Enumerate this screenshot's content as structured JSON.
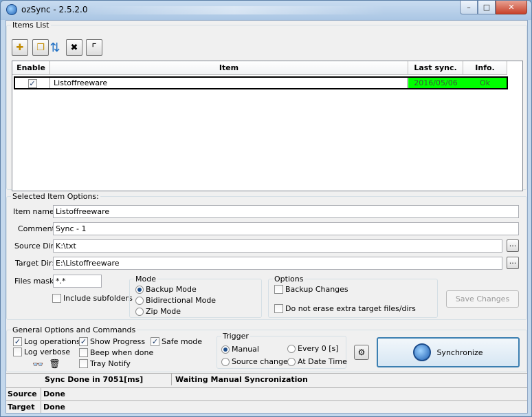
{
  "window": {
    "title": "ozSync - 2.5.2.0",
    "min": "–",
    "max": "□",
    "close": "✕"
  },
  "items_list": {
    "legend": "Items List",
    "toolbar": [
      {
        "name": "new-item-button",
        "glyph": "✚"
      },
      {
        "name": "copy-item-button",
        "glyph": "❐"
      },
      {
        "name": "move-item-button",
        "glyph": "⇅"
      },
      {
        "name": "delete-item-button",
        "glyph": "✖"
      },
      {
        "name": "properties-button",
        "glyph": "⌜"
      }
    ],
    "columns": {
      "enable": "Enable",
      "item": "Item",
      "last_sync": "Last sync.",
      "info": "Info."
    },
    "rows": [
      {
        "enabled": true,
        "item": "Listoffreeware",
        "last_sync": "2016/05/06",
        "info": "Ok"
      }
    ],
    "status_color": "#00ff00"
  },
  "options": {
    "legend": "Selected Item Options:",
    "item_name_label": "Item name:",
    "item_name": "Listoffreeware",
    "comment_label": "Comment:",
    "comment": "Sync - 1",
    "source_label": "Source Dir:",
    "source": "K:\\txt",
    "target_label": "Target Dir:",
    "target": "E:\\Listoffreeware",
    "browse": "...",
    "mask_label": "Files mask:",
    "mask": "*.*",
    "include_subfolders": "Include subfolders",
    "mode_legend": "Mode",
    "modes": [
      "Backup Mode",
      "Bidirectional Mode",
      "Zip Mode"
    ],
    "options_legend": "Options",
    "backup_changes": "Backup Changes",
    "no_erase": "Do not erase extra target files/dirs",
    "save_changes": "Save Changes"
  },
  "general": {
    "legend": "General Options and Commands",
    "log_operations": "Log operations",
    "log_verbose": "Log verbose",
    "show_progress": "Show Progress",
    "beep": "Beep when done",
    "tray_notify": "Tray Notify",
    "safe_mode": "Safe mode",
    "trigger_legend": "Trigger",
    "manual": "Manual",
    "source_change": "Source change",
    "every": "Every 0 [s]",
    "at_date_time": "At Date Time",
    "synchronize": "Synchronize"
  },
  "status": {
    "sync_done": "Sync Done in 7051[ms]",
    "waiting": "Waiting Manual Syncronization",
    "source_label": "Source",
    "source_value": "Done",
    "target_label": "Target",
    "target_value": "Done"
  }
}
